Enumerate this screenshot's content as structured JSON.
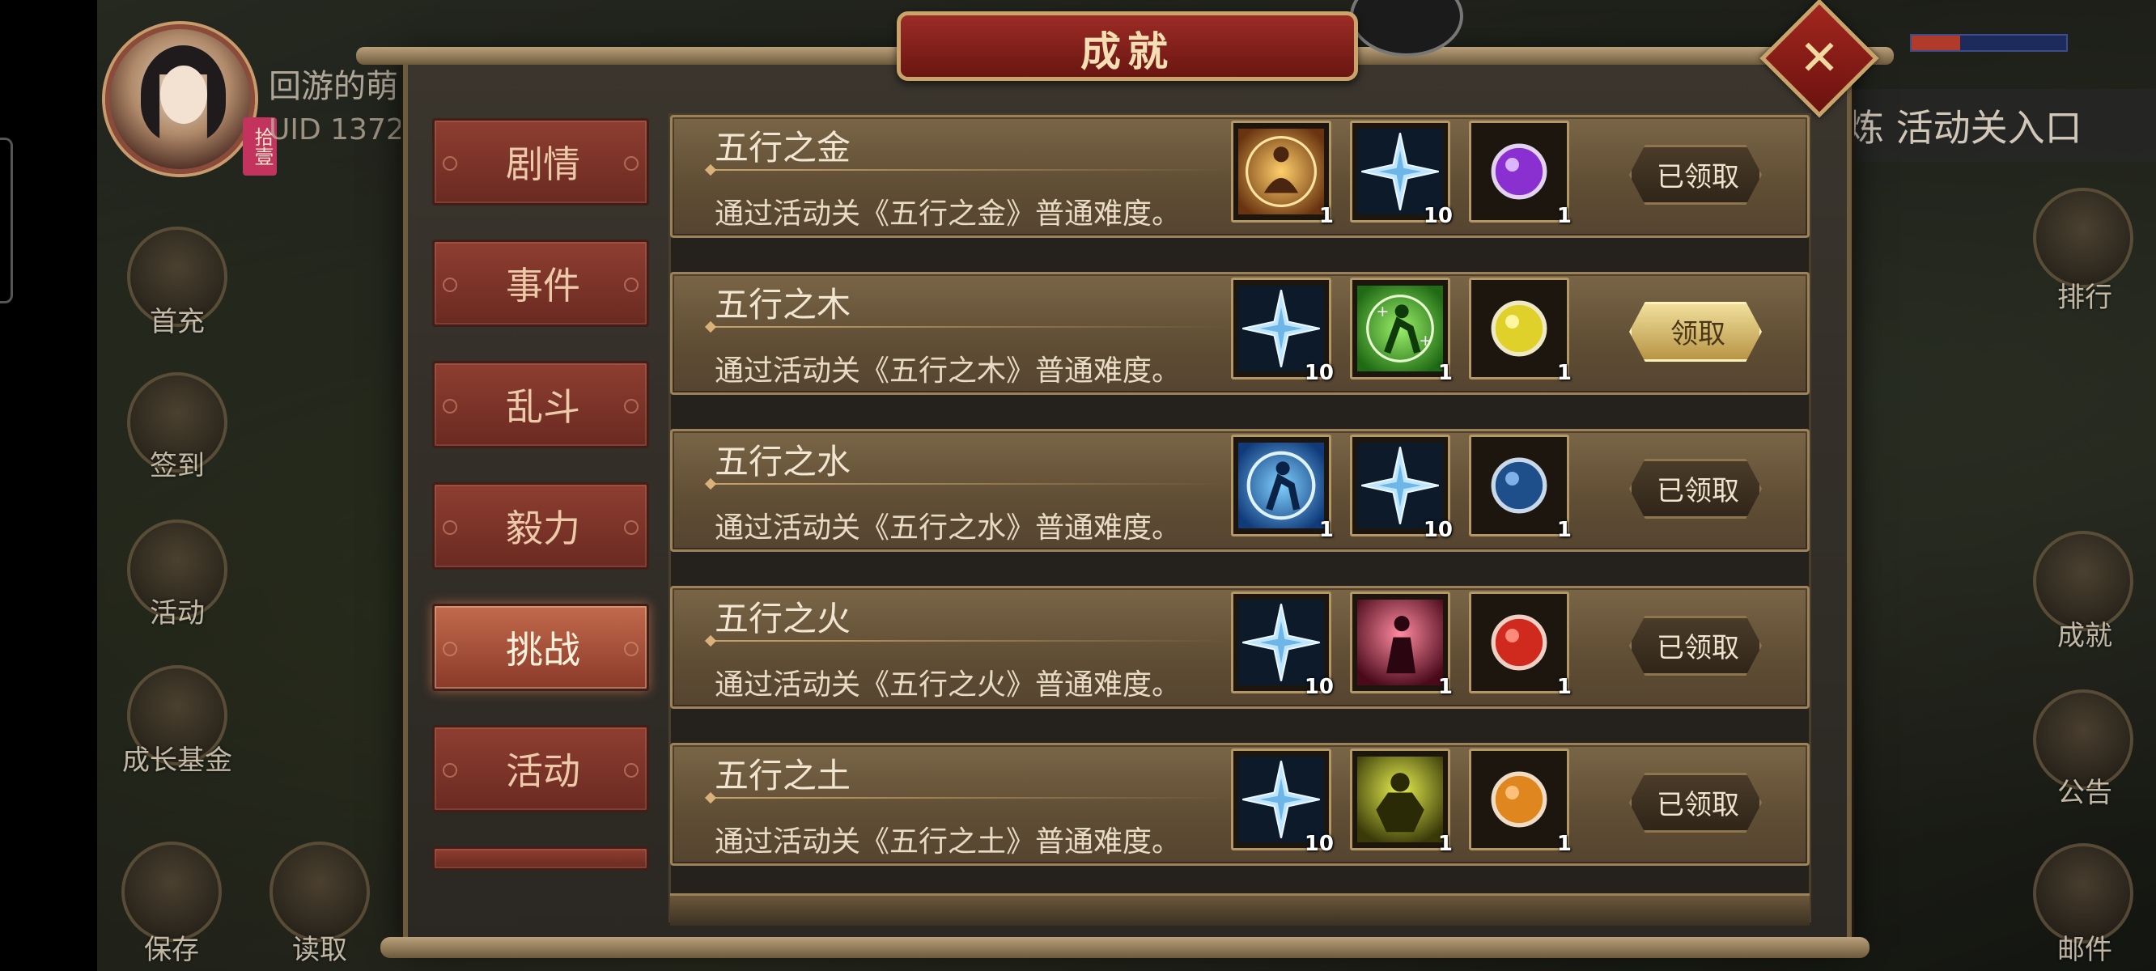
{
  "player": {
    "name": "回游的萌",
    "uid": "UID  1372",
    "avatar_tag": "拾壹"
  },
  "side_left": [
    {
      "label": "首充",
      "icon": "gift-box-icon"
    },
    {
      "label": "签到",
      "icon": "scroll-pen-icon"
    },
    {
      "label": "活动",
      "icon": "flower-basket-icon"
    },
    {
      "label": "成长基金",
      "icon": "plant-icon"
    },
    {
      "label": "保存",
      "icon": "save-down-icon"
    },
    {
      "label": "读取",
      "icon": "load-up-icon"
    }
  ],
  "side_right": [
    {
      "label": "排行",
      "icon": "ranking-plaque-icon"
    },
    {
      "label": "成就",
      "icon": "achievement-icon"
    },
    {
      "label": "公告",
      "icon": "notice-scroll-icon"
    },
    {
      "label": "邮件",
      "icon": "mail-icon"
    }
  ],
  "right_banner": "炼 活动关入口",
  "dialog": {
    "title": "成就",
    "close_icon": "close-x-icon"
  },
  "tabs": [
    {
      "label": "剧情",
      "active": false
    },
    {
      "label": "事件",
      "active": false
    },
    {
      "label": "乱斗",
      "active": false
    },
    {
      "label": "毅力",
      "active": false
    },
    {
      "label": "挑战",
      "active": true
    },
    {
      "label": "活动",
      "active": false
    }
  ],
  "achievements": [
    {
      "title": "五行之金",
      "desc": "通过活动关《五行之金》普通难度。",
      "rewards": [
        {
          "icon": "golden-meditation-icon",
          "count": "1"
        },
        {
          "icon": "ice-crystal-icon",
          "count": "10"
        },
        {
          "icon": "purple-orb-icon",
          "count": "1"
        }
      ],
      "button": "已领取",
      "claimable": false
    },
    {
      "title": "五行之木",
      "desc": "通过活动关《五行之木》普通难度。",
      "rewards": [
        {
          "icon": "ice-crystal-icon",
          "count": "10"
        },
        {
          "icon": "green-healing-figure-icon",
          "count": "1"
        },
        {
          "icon": "yellow-orb-icon",
          "count": "1"
        }
      ],
      "button": "领取",
      "claimable": true
    },
    {
      "title": "五行之水",
      "desc": "通过活动关《五行之水》普通难度。",
      "rewards": [
        {
          "icon": "blue-water-figure-icon",
          "count": "1"
        },
        {
          "icon": "ice-crystal-icon",
          "count": "10"
        },
        {
          "icon": "blue-orb-icon",
          "count": "1"
        }
      ],
      "button": "已领取",
      "claimable": false
    },
    {
      "title": "五行之火",
      "desc": "通过活动关《五行之火》普通难度。",
      "rewards": [
        {
          "icon": "ice-crystal-icon",
          "count": "10"
        },
        {
          "icon": "red-fire-figure-icon",
          "count": "1"
        },
        {
          "icon": "red-orb-icon",
          "count": "1"
        }
      ],
      "button": "已领取",
      "claimable": false
    },
    {
      "title": "五行之土",
      "desc": "通过活动关《五行之土》普通难度。",
      "rewards": [
        {
          "icon": "ice-crystal-icon",
          "count": "10"
        },
        {
          "icon": "earth-golem-icon",
          "count": "1"
        },
        {
          "icon": "orange-orb-icon",
          "count": "1"
        }
      ],
      "button": "已领取",
      "claimable": false
    }
  ],
  "colors": {
    "tab_active": "#c26a4c",
    "tab_inactive": "#8e3e31",
    "claim_gold": "#f1df9b",
    "row_bg": "#7a6546",
    "title_red": "#9c2b25"
  }
}
